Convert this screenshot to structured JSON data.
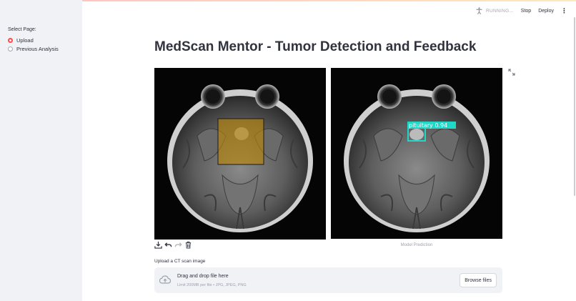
{
  "sidebar": {
    "label": "Select Page:",
    "options": [
      {
        "label": "Upload",
        "selected": true
      },
      {
        "label": "Previous Analysis",
        "selected": false
      }
    ]
  },
  "header": {
    "status": "RUNNING...",
    "stop_label": "Stop",
    "deploy_label": "Deploy",
    "status_icon": "running-person-icon",
    "menu_icon": "kebab-menu-icon"
  },
  "main": {
    "title": "MedScan Mentor - Tumor Detection and Feedback",
    "prediction": {
      "label": "pituitary",
      "confidence": "0.94",
      "box_color": "#1fd8c8"
    },
    "highlight_color": "#b8860b",
    "caption": "Model Prediction",
    "image_tools": [
      "download-icon",
      "undo-icon",
      "redo-icon",
      "trash-icon"
    ]
  },
  "uploader": {
    "label": "Upload a CT scan image",
    "title": "Drag and drop file here",
    "subtitle": "Limit 200MB per file • JPG, JPEG, PNG",
    "browse_label": "Browse files"
  },
  "colors": {
    "accent": "#ff4b4b",
    "sidebar_bg": "#f0f2f6",
    "text": "#31333f"
  }
}
